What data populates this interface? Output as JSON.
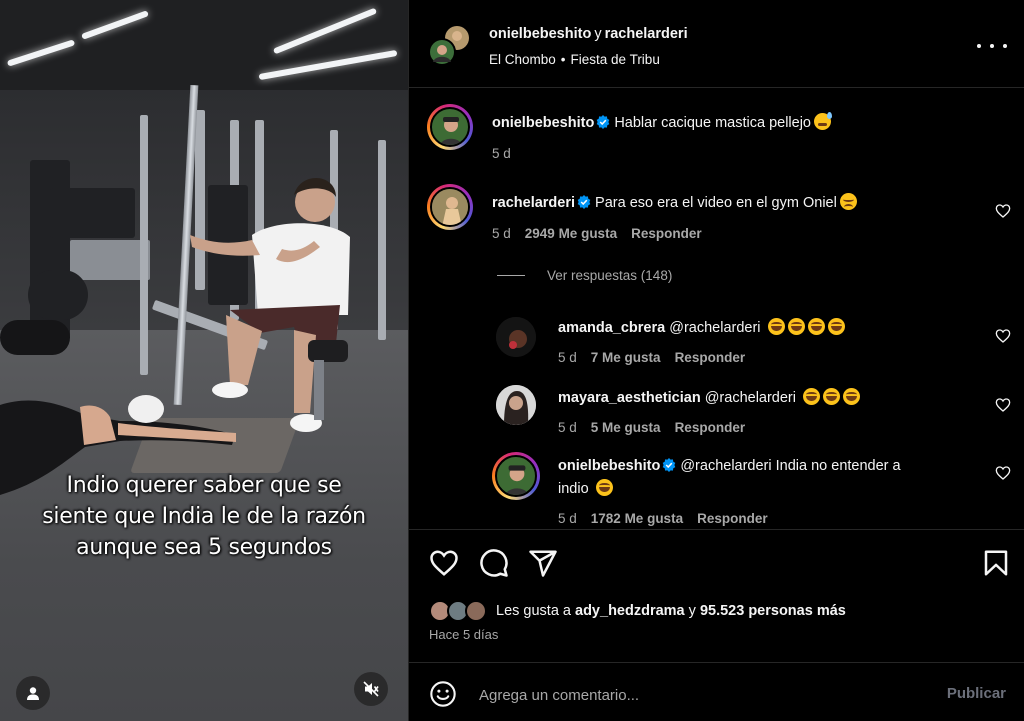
{
  "post": {
    "authors": [
      "onielbebeshito",
      "rachelarderi"
    ],
    "connector": "y",
    "audio": "El Chombo",
    "audio_separator": "•",
    "song": "Fiesta de Tribu"
  },
  "video": {
    "caption_lines": [
      "Indio querer saber que se",
      "siente que India le de la razón",
      "aunque sea 5 segundos"
    ]
  },
  "comments": [
    {
      "user": "onielbebeshito",
      "verified": true,
      "text": "Hablar cacique mastica pellejo",
      "emoji": "sweat",
      "time": "5 d"
    },
    {
      "user": "rachelarderi",
      "verified": true,
      "text": "Para eso era el video en el gym Oniel",
      "emoji": "sad",
      "time": "5 d",
      "likes": "2949 Me gusta",
      "reply_label": "Responder"
    }
  ],
  "view_replies": "Ver respuestas (148)",
  "replies": [
    {
      "user": "amanda_cbrera",
      "verified": false,
      "text": "@rachelarderi",
      "emoji_count": 4,
      "time": "5 d",
      "likes": "7 Me gusta",
      "reply_label": "Responder"
    },
    {
      "user": "mayara_aesthetician",
      "verified": false,
      "text": "@rachelarderi",
      "emoji_count": 3,
      "time": "5 d",
      "likes": "5 Me gusta",
      "reply_label": "Responder"
    },
    {
      "user": "onielbebeshito",
      "verified": true,
      "text_line1": "@rachelarderi India no entender a",
      "text_line2": "indio",
      "emoji_count": 1,
      "time": "5 d",
      "likes": "1782 Me gusta",
      "reply_label": "Responder"
    }
  ],
  "likes": {
    "prefix": "Les gusta a",
    "user": "ady_hedzdrama",
    "connector": "y",
    "others": "95.523 personas más"
  },
  "posted_ago": "Hace 5 días",
  "composer": {
    "placeholder": "Agrega un comentario...",
    "publish_label": "Publicar"
  },
  "colors": {
    "background": "#000000",
    "text": "#f5f5f5",
    "secondary_text": "#a8a8a8",
    "verified_blue": "#0095f6",
    "separator": "#262626"
  },
  "icons": [
    "more-icon",
    "verified-icon",
    "heart-icon",
    "comment-icon",
    "share-icon",
    "bookmark-icon",
    "emoji-icon",
    "profile-icon",
    "mute-icon"
  ]
}
